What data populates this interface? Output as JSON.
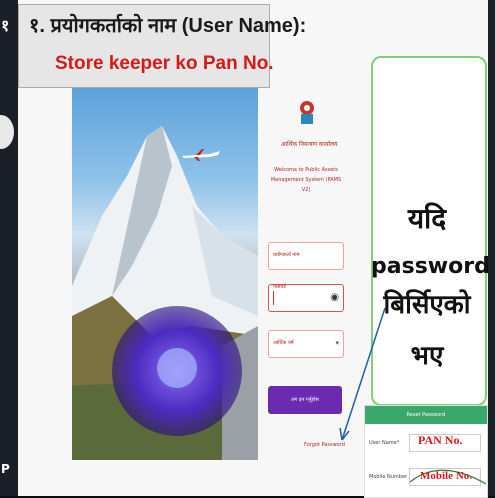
{
  "overlay": {
    "line1": "१. प्रयोगकर्ताको नाम (User Name):",
    "line2": "Store keeper ko Pan No."
  },
  "left": {
    "one": "१",
    "p": "P"
  },
  "login": {
    "org": "आर्थिक नियन्त्रण कार्यालय",
    "welcome": "Welcome to Public Assets Management System (PAMS V2)",
    "username_label": "प्रयोगकर्ता नाम",
    "password_label": "पासवर्ड",
    "fiscal_label": "आर्थिक वर्ष",
    "login_button": "लग इन गर्नुहोस",
    "forgot_link": "Forgot Password"
  },
  "annotation": {
    "word1": "यदि",
    "word2": "password",
    "word3": "बिर्सिएको",
    "word4": "भए"
  },
  "reset": {
    "title": "Reset Password",
    "user_name_label": "User Name*",
    "mobile_label": "Mobile Number / Email*",
    "pan_note": "PAN No.",
    "mobile_note": "Mobile No."
  },
  "colors": {
    "accent_red": "#d81818",
    "button_purple": "#6a2bb0",
    "note_border": "#7fcf7f"
  }
}
